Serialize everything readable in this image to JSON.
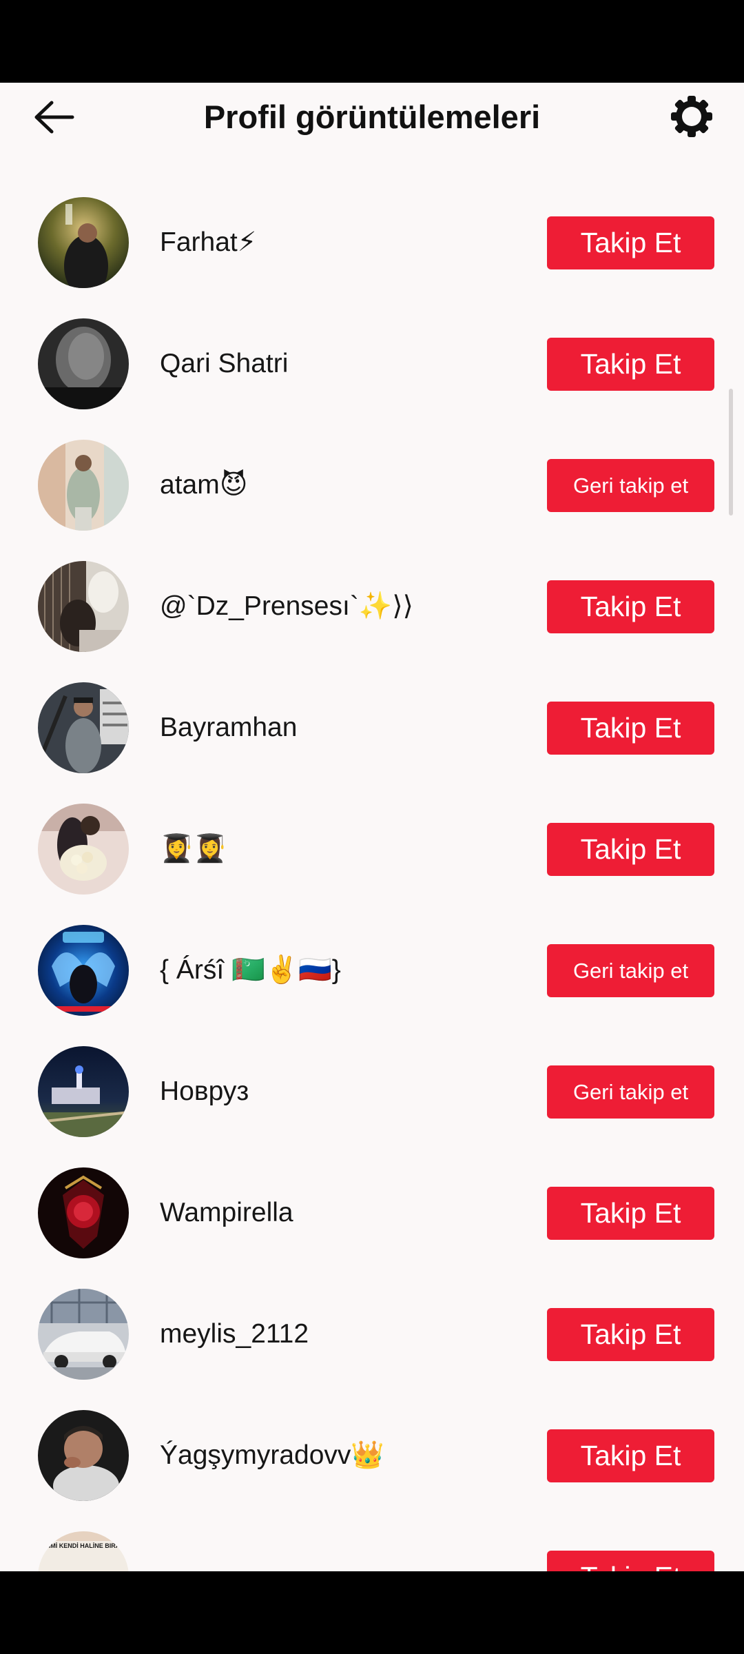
{
  "header": {
    "title": "Profil görüntülemeleri",
    "back_icon": "arrow-left-icon",
    "settings_icon": "gear-icon"
  },
  "colors": {
    "background": "#fbf8f8",
    "button": "#ee1d35",
    "button_text": "#ffffff",
    "text": "#161616"
  },
  "users": [
    {
      "name": "Farhat⚡",
      "button": "Takip Et",
      "type": "follow"
    },
    {
      "name": "Qari Shatri",
      "button": "Takip Et",
      "type": "follow"
    },
    {
      "name": "atam😈",
      "button": "Geri takip et",
      "type": "followback"
    },
    {
      "name": "@`Dz_Prensesı`✨⟩⟩",
      "button": "Takip Et",
      "type": "follow"
    },
    {
      "name": "Bayramhan",
      "button": "Takip Et",
      "type": "follow"
    },
    {
      "name": "👩‍🎓👩‍🎓",
      "button": "Takip Et",
      "type": "follow"
    },
    {
      "name": "{ Árśî 🇹🇲✌️🇷🇺}",
      "button": "Geri takip et",
      "type": "followback"
    },
    {
      "name": "Новруз",
      "button": "Geri takip et",
      "type": "followback"
    },
    {
      "name": "Wampirella",
      "button": "Takip Et",
      "type": "follow"
    },
    {
      "name": "meylis_2112",
      "button": "Takip Et",
      "type": "follow"
    },
    {
      "name": "Ýagşymyradovv👑",
      "button": "Takip Et",
      "type": "follow"
    },
    {
      "name": "",
      "button": "Takip Et",
      "type": "follow",
      "avatar_text": "BU GÜN KENDİMİ KENDİ HALİNE BIRAKTIM NE HALİ"
    }
  ]
}
